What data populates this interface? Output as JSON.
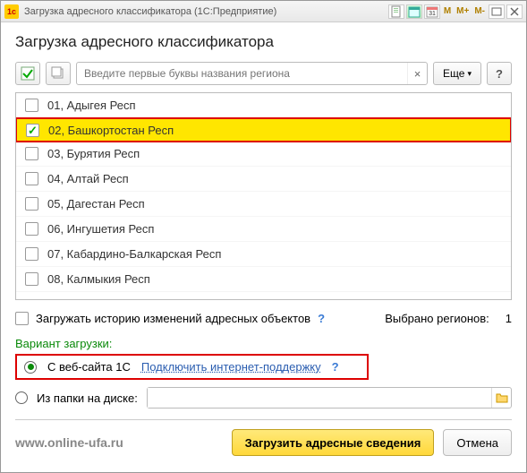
{
  "titlebar": {
    "title": "Загрузка адресного классификатора  (1С:Предприятие)"
  },
  "header": {
    "title": "Загрузка адресного классификатора"
  },
  "toolbar": {
    "search_placeholder": "Введите первые буквы названия региона",
    "more_label": "Еще",
    "help_label": "?"
  },
  "regions": [
    {
      "label": "01, Адыгея Респ",
      "checked": false,
      "highlight": false
    },
    {
      "label": "02, Башкортостан Респ",
      "checked": true,
      "highlight": true
    },
    {
      "label": "03, Бурятия Респ",
      "checked": false,
      "highlight": false
    },
    {
      "label": "04, Алтай Респ",
      "checked": false,
      "highlight": false
    },
    {
      "label": "05, Дагестан Респ",
      "checked": false,
      "highlight": false
    },
    {
      "label": "06, Ингушетия Респ",
      "checked": false,
      "highlight": false
    },
    {
      "label": "07, Кабардино-Балкарская Респ",
      "checked": false,
      "highlight": false
    },
    {
      "label": "08, Калмыкия Респ",
      "checked": false,
      "highlight": false
    }
  ],
  "options": {
    "history_label": "Загружать историю изменений адресных объектов",
    "selected_label": "Выбрано регионов:",
    "selected_count": "1",
    "variant_label": "Вариант загрузки:",
    "radio_web_label": "С веб-сайта 1С",
    "connect_link": "Подключить интернет-поддержку",
    "radio_folder_label": "Из папки на диске:"
  },
  "footer": {
    "url": "www.online-ufa.ru",
    "load_label": "Загрузить адресные сведения",
    "cancel_label": "Отмена"
  }
}
